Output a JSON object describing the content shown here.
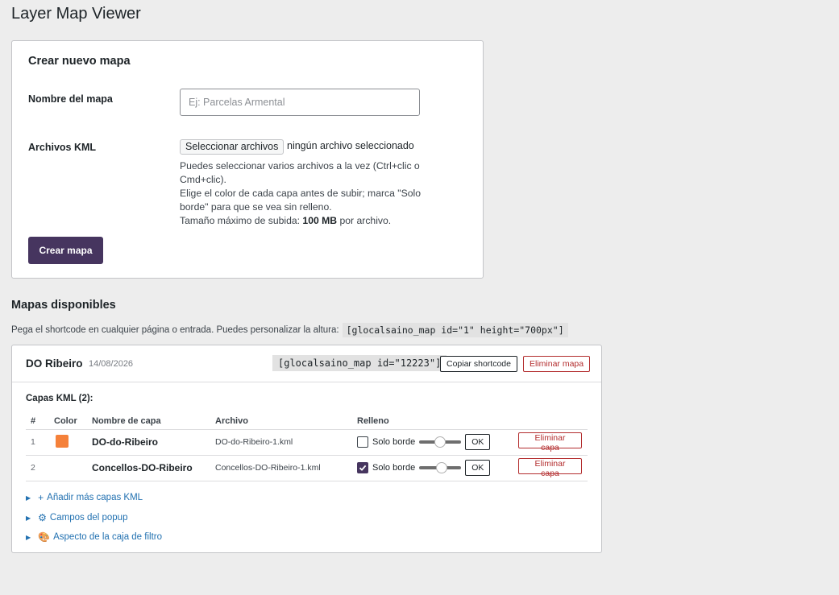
{
  "page": {
    "title": "Layer Map Viewer"
  },
  "create": {
    "heading": "Crear nuevo mapa",
    "name_label": "Nombre del mapa",
    "name_placeholder": "Ej: Parcelas Armental",
    "kml_label": "Archivos KML",
    "file_button": "Seleccionar archivos",
    "file_status": "ningún archivo seleccionado",
    "help_line1": "Puedes seleccionar varios archivos a la vez (Ctrl+clic o Cmd+clic).",
    "help_line2": "Elige el color de cada capa antes de subir; marca \"Solo borde\" para que se vea sin relleno.",
    "help_line3_pre": "Tamaño máximo de subida: ",
    "help_line3_bold": "100 MB",
    "help_line3_post": " por archivo.",
    "submit": "Crear mapa"
  },
  "maps": {
    "heading": "Mapas disponibles",
    "desc": "Pega el shortcode en cualquier página o entrada. Puedes personalizar la altura:",
    "example_code": "[glocalsaino_map id=\"1\" height=\"700px\"]",
    "items": [
      {
        "name": "DO Ribeiro",
        "date": "14/08/2026",
        "shortcode": "[glocalsaino_map id=\"12223\"]",
        "copy_label": "Copiar shortcode",
        "delete_label": "Eliminar mapa",
        "layers_title": "Capas KML (2):",
        "columns": [
          "#",
          "Color",
          "Nombre de capa",
          "Archivo",
          "Relleno"
        ],
        "layers": [
          {
            "num": "1",
            "color": "#f5813a",
            "name": "DO-do-Ribeiro",
            "file": "DO-do-Ribeiro-1.kml",
            "border_only": false,
            "fill_label": "Solo borde",
            "opacity": 0.5,
            "ok": "OK",
            "delete": "Eliminar capa"
          },
          {
            "num": "2",
            "color": "",
            "name": "Concellos-DO-Ribeiro",
            "file": "Concellos-DO-Ribeiro-1.kml",
            "border_only": true,
            "fill_label": "Solo borde",
            "opacity": 0.55,
            "ok": "OK",
            "delete": "Eliminar capa"
          }
        ],
        "expanders": [
          {
            "icon": "+",
            "icon_name": "plus-icon",
            "label": "Añadir más capas KML"
          },
          {
            "icon": "⚙",
            "icon_name": "gear-icon",
            "label": "Campos del popup"
          },
          {
            "icon": "🎨",
            "icon_name": "palette-icon",
            "label": "Aspecto de la caja de filtro"
          }
        ]
      }
    ]
  },
  "colors": {
    "primary": "#46355f",
    "danger": "#b32d2e",
    "link": "#2271b1"
  }
}
